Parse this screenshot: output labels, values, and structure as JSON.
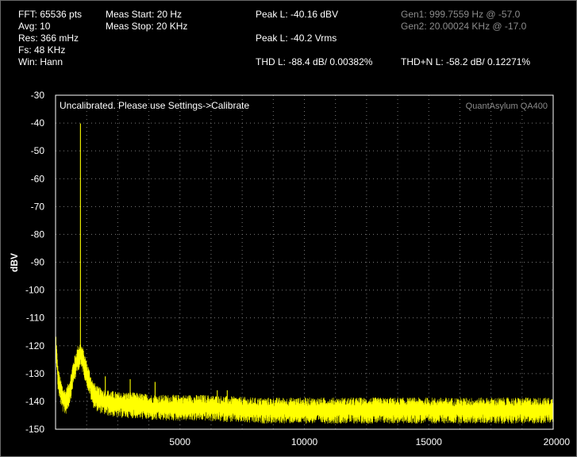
{
  "header": {
    "col1": [
      "FFT: 65536 pts",
      "Avg: 10",
      "Res: 366 mHz",
      "Fs: 48 KHz",
      "Win: Hann"
    ],
    "col2": [
      "Meas Start: 20 Hz",
      "Meas Stop: 20 KHz"
    ],
    "peak_dbv": "Peak L: -40.16 dBV",
    "peak_vrms": "Peak L: -40.2 Vrms",
    "thd": "THD L: -88.4 dB/ 0.00382%",
    "gen1": "Gen1: 999.7559 Hz @ -57.0",
    "gen2": "Gen2: 20.00024 KHz @ -17.0",
    "thdn": "THD+N L: -58.2 dB/ 0.12271%"
  },
  "plot": {
    "annotation": "Uncalibrated. Please use Settings->Calibrate",
    "brand": "QuantAsylum QA400"
  },
  "colors": {
    "trace": "#ffff00",
    "grid": "#7a7a7a",
    "frame": "#ffffff",
    "dim_text": "#8c8c8c",
    "background": "#000000"
  },
  "chart_data": {
    "type": "line",
    "title": "",
    "xlabel": "",
    "ylabel": "dBV",
    "xlim": [
      0,
      20000
    ],
    "ylim": [
      -150,
      -30
    ],
    "x_ticks": [
      5000,
      10000,
      15000,
      20000
    ],
    "x_tick_labels": [
      "5000",
      "10000",
      "15000",
      "20000"
    ],
    "y_ticks": [
      -30,
      -40,
      -50,
      -60,
      -70,
      -80,
      -90,
      -100,
      -110,
      -120,
      -130,
      -140,
      -150
    ],
    "y_tick_labels": [
      "-30",
      "-40",
      "-50",
      "-60",
      "-70",
      "-80",
      "-90",
      "-100",
      "-110",
      "-120",
      "-130",
      "-140",
      "-150"
    ],
    "grid": true,
    "legend": "none",
    "series": [
      {
        "color": "#ffff00",
        "noise_floor": [
          [
            20,
            -120
          ],
          [
            100,
            -132
          ],
          [
            200,
            -136
          ],
          [
            300,
            -139
          ],
          [
            400,
            -140
          ],
          [
            500,
            -138
          ],
          [
            600,
            -135
          ],
          [
            700,
            -130
          ],
          [
            800,
            -127
          ],
          [
            900,
            -124
          ],
          [
            1000,
            -123
          ],
          [
            1100,
            -125
          ],
          [
            1200,
            -128
          ],
          [
            1300,
            -131
          ],
          [
            1400,
            -134
          ],
          [
            1500,
            -137
          ],
          [
            1700,
            -139
          ],
          [
            2000,
            -140
          ],
          [
            2500,
            -141
          ],
          [
            3000,
            -141
          ],
          [
            4000,
            -142
          ],
          [
            5000,
            -142
          ],
          [
            6000,
            -142
          ],
          [
            8000,
            -143
          ],
          [
            10000,
            -143
          ],
          [
            12000,
            -143
          ],
          [
            14000,
            -143
          ],
          [
            16000,
            -143
          ],
          [
            18000,
            -143
          ],
          [
            20000,
            -143
          ]
        ],
        "peaks": [
          [
            1000,
            -40.16
          ],
          [
            2000,
            -131
          ],
          [
            3000,
            -132
          ],
          [
            4000,
            -133
          ],
          [
            5000,
            -139
          ],
          [
            6500,
            -136
          ],
          [
            6900,
            -136
          ]
        ]
      }
    ]
  }
}
